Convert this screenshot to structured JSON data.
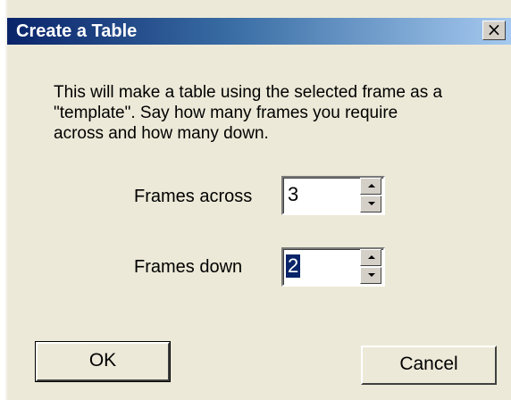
{
  "dialog": {
    "title": "Create a Table",
    "close_glyph": "×",
    "description_lines": [
      "This will make a table using the selected frame as a",
      "\"template\".  Say how many frames you require",
      "across and how many down."
    ],
    "fields": {
      "across": {
        "label": "Frames across",
        "value": "3"
      },
      "down": {
        "label": "Frames down",
        "value": "2"
      }
    },
    "buttons": {
      "ok": "OK",
      "cancel": "Cancel"
    }
  },
  "colors": {
    "titlebar_start": "#0a246a",
    "titlebar_end": "#a6caf0",
    "dialog_background": "#ece9d8",
    "selection": "#0a246a"
  }
}
